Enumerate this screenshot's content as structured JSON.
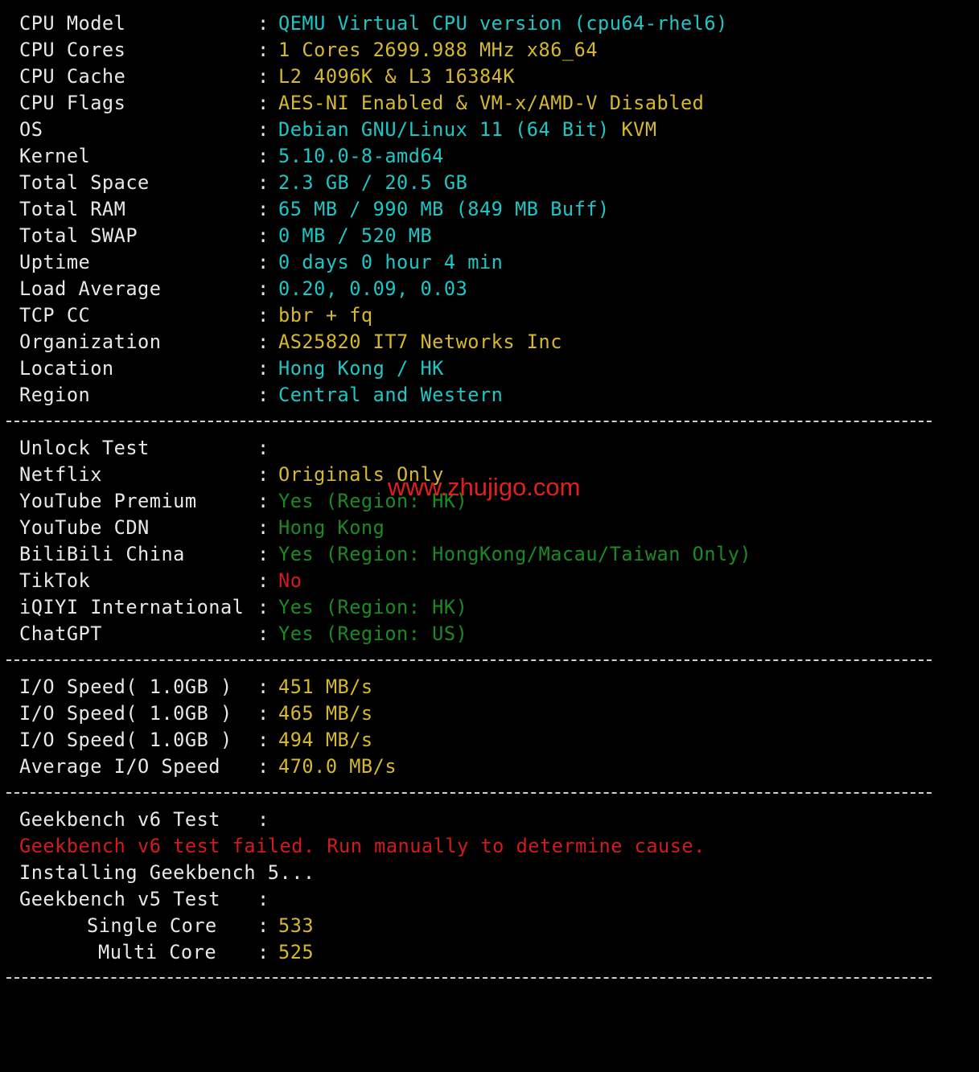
{
  "system": [
    {
      "label": "CPU Model",
      "parts": [
        {
          "text": "QEMU Virtual CPU version (cpu64-rhel6)",
          "color": "cyan"
        }
      ]
    },
    {
      "label": "CPU Cores",
      "parts": [
        {
          "text": "1 Cores 2699.988 MHz x86_64",
          "color": "yellow"
        }
      ]
    },
    {
      "label": "CPU Cache",
      "parts": [
        {
          "text": "L2 4096K & L3 16384K",
          "color": "yellow"
        }
      ]
    },
    {
      "label": "CPU Flags",
      "parts": [
        {
          "text": "AES-NI Enabled & VM-x/AMD-V Disabled",
          "color": "yellow"
        }
      ]
    },
    {
      "label": "OS",
      "parts": [
        {
          "text": "Debian GNU/Linux 11 (64 Bit) ",
          "color": "cyan"
        },
        {
          "text": "KVM",
          "color": "yellow"
        }
      ]
    },
    {
      "label": "Kernel",
      "parts": [
        {
          "text": "5.10.0-8-amd64",
          "color": "cyan"
        }
      ]
    },
    {
      "label": "Total Space",
      "parts": [
        {
          "text": "2.3 GB / 20.5 GB",
          "color": "cyan"
        }
      ]
    },
    {
      "label": "Total RAM",
      "parts": [
        {
          "text": "65 MB / 990 MB (849 MB Buff)",
          "color": "cyan"
        }
      ]
    },
    {
      "label": "Total SWAP",
      "parts": [
        {
          "text": "0 MB / 520 MB",
          "color": "cyan"
        }
      ]
    },
    {
      "label": "Uptime",
      "parts": [
        {
          "text": "0 days 0 hour 4 min",
          "color": "cyan"
        }
      ]
    },
    {
      "label": "Load Average",
      "parts": [
        {
          "text": "0.20, 0.09, 0.03",
          "color": "cyan"
        }
      ]
    },
    {
      "label": "TCP CC",
      "parts": [
        {
          "text": "bbr + fq",
          "color": "yellow"
        }
      ]
    },
    {
      "label": "Organization",
      "parts": [
        {
          "text": "AS25820 IT7 Networks Inc",
          "color": "yellow"
        }
      ]
    },
    {
      "label": "Location",
      "parts": [
        {
          "text": "Hong Kong / HK",
          "color": "cyan"
        }
      ]
    },
    {
      "label": "Region",
      "parts": [
        {
          "text": "Central and Western",
          "color": "cyan"
        }
      ]
    }
  ],
  "unlock": [
    {
      "label": "Unlock Test",
      "parts": []
    },
    {
      "label": "Netflix",
      "parts": [
        {
          "text": "Originals Only",
          "color": "yellow"
        }
      ]
    },
    {
      "label": "YouTube Premium",
      "parts": [
        {
          "text": "Yes (Region: HK)",
          "color": "green"
        }
      ]
    },
    {
      "label": "YouTube CDN",
      "parts": [
        {
          "text": "Hong Kong",
          "color": "green"
        }
      ]
    },
    {
      "label": "BiliBili China",
      "parts": [
        {
          "text": "Yes (Region: HongKong/Macau/Taiwan Only)",
          "color": "green"
        }
      ]
    },
    {
      "label": "TikTok",
      "parts": [
        {
          "text": "No",
          "color": "red"
        }
      ]
    },
    {
      "label": "iQIYI International",
      "parts": [
        {
          "text": "Yes (Region: HK)",
          "color": "green"
        }
      ]
    },
    {
      "label": "ChatGPT",
      "parts": [
        {
          "text": "Yes (Region: US)",
          "color": "green"
        }
      ]
    }
  ],
  "io": [
    {
      "label": "I/O Speed( 1.0GB )",
      "parts": [
        {
          "text": "451 MB/s",
          "color": "yellow"
        }
      ]
    },
    {
      "label": "I/O Speed( 1.0GB )",
      "parts": [
        {
          "text": "465 MB/s",
          "color": "yellow"
        }
      ]
    },
    {
      "label": "I/O Speed( 1.0GB )",
      "parts": [
        {
          "text": "494 MB/s",
          "color": "yellow"
        }
      ]
    },
    {
      "label": "Average I/O Speed",
      "parts": [
        {
          "text": "470.0 MB/s",
          "color": "yellow"
        }
      ]
    }
  ],
  "geekbench": {
    "v6_label": "Geekbench v6 Test",
    "v6_error": "Geekbench v6 test failed. Run manually to determine cause.",
    "installing": "Installing Geekbench 5...",
    "v5_label": "Geekbench v5 Test",
    "single_label": "Single Core",
    "single_value": "533",
    "multi_label": "Multi Core",
    "multi_value": "525"
  },
  "colon": ":",
  "watermark": "www.zhujigo.com",
  "colors": {
    "cyan": "#1fc6c6",
    "yellow": "#d6b82c",
    "green": "#1c8a22",
    "red": "#d41b1b",
    "white": "#e8e8e8"
  }
}
